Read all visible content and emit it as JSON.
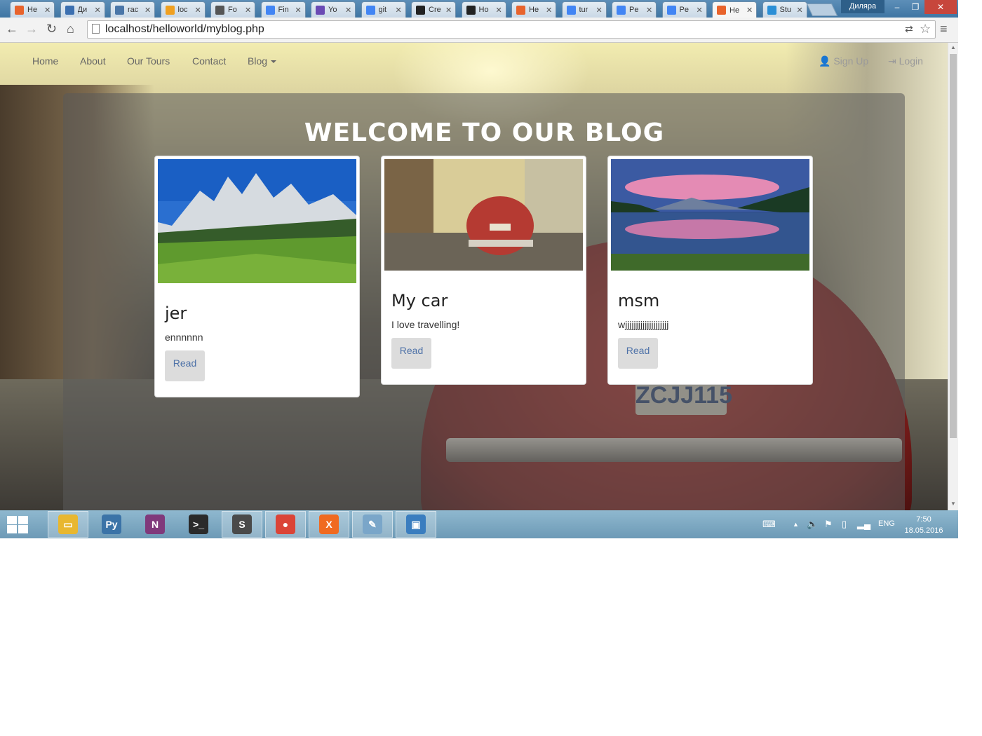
{
  "browser": {
    "tabs": [
      {
        "title": "He",
        "icon": "xampp-icon",
        "color": "#e8632c"
      },
      {
        "title": "Ди",
        "icon": "chat-icon",
        "color": "#3b6fb0"
      },
      {
        "title": "rac",
        "icon": "vk-icon",
        "color": "#4a76a8"
      },
      {
        "title": "loc",
        "icon": "phpmyadmin-icon",
        "color": "#f0a020"
      },
      {
        "title": "Fo",
        "icon": "contacts-icon",
        "color": "#555555"
      },
      {
        "title": "Fin",
        "icon": "docs-icon",
        "color": "#4285f4"
      },
      {
        "title": "Yo",
        "icon": "forms-icon",
        "color": "#6a4ab4"
      },
      {
        "title": "git",
        "icon": "google-icon",
        "color": "#4285f4"
      },
      {
        "title": "Cre",
        "icon": "github-icon",
        "color": "#222222"
      },
      {
        "title": "Ho",
        "icon": "github-icon",
        "color": "#222222"
      },
      {
        "title": "He",
        "icon": "xampp-icon",
        "color": "#e8632c"
      },
      {
        "title": "tur",
        "icon": "google-icon",
        "color": "#4285f4"
      },
      {
        "title": "Pe",
        "icon": "google-icon",
        "color": "#4285f4"
      },
      {
        "title": "Pe",
        "icon": "google-icon",
        "color": "#4285f4"
      },
      {
        "title": "He",
        "icon": "xampp-icon",
        "color": "#e8632c",
        "active": true
      },
      {
        "title": "Stu",
        "icon": "stackoverflow-icon",
        "color": "#2b8fd6"
      }
    ],
    "profile_name": "Диляра",
    "window_controls": {
      "minimize": "–",
      "maximize": "❐",
      "close": "✕"
    },
    "url": "localhost/helloworld/myblog.php"
  },
  "site": {
    "nav": {
      "home": "Home",
      "about": "About",
      "tours": "Our Tours",
      "contact": "Contact",
      "blog": "Blog",
      "signup": "Sign Up",
      "login": "Login"
    },
    "heading": "WELCOME TO OUR BLOG",
    "posts": [
      {
        "title": "jer",
        "text": "ennnnnn",
        "button": "Read",
        "image": "mountain-meadow"
      },
      {
        "title": "My car",
        "text": "I love travelling!",
        "button": "Read",
        "image": "red-beetle-car"
      },
      {
        "title": "msm",
        "text": "wjjjjjjjjjjjjjjjjjjjj",
        "button": "Read",
        "image": "mountain-lake-sunset"
      }
    ]
  },
  "taskbar": {
    "apps": [
      {
        "name": "file-explorer",
        "color": "#e8b730",
        "glyph": "▭",
        "running": true
      },
      {
        "name": "python",
        "color": "#3b73a7",
        "glyph": "Py",
        "running": false
      },
      {
        "name": "onenote",
        "color": "#80397b",
        "glyph": "N",
        "running": false
      },
      {
        "name": "terminal",
        "color": "#2a2a2a",
        "glyph": ">_",
        "running": false
      },
      {
        "name": "sublime-text",
        "color": "#4a4a4a",
        "glyph": "S",
        "running": true
      },
      {
        "name": "chrome",
        "color": "#db4437",
        "glyph": "●",
        "running": true
      },
      {
        "name": "xampp",
        "color": "#f06a20",
        "glyph": "X",
        "running": true
      },
      {
        "name": "paint",
        "color": "#7aa6c9",
        "glyph": "✎",
        "running": true
      },
      {
        "name": "photo-viewer",
        "color": "#3a7dbf",
        "glyph": "▣",
        "running": true
      }
    ],
    "language": "ENG",
    "time": "7:50",
    "date": "18.05.2016"
  }
}
